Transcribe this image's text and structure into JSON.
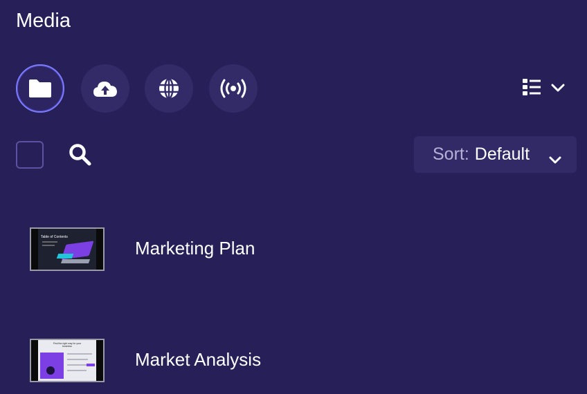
{
  "header": {
    "title": "Media"
  },
  "sources": [
    {
      "name": "folder-icon",
      "active": true
    },
    {
      "name": "cloud-upload-icon",
      "active": false
    },
    {
      "name": "globe-icon",
      "active": false
    },
    {
      "name": "broadcast-icon",
      "active": false
    }
  ],
  "toolbar": {
    "view_icon": "list-view-icon",
    "sort_label": "Sort:",
    "sort_value": "Default"
  },
  "items": [
    {
      "label": "Marketing Plan",
      "thumb_caption": "Table of Contents"
    },
    {
      "label": "Market Analysis",
      "thumb_caption": "Find the right way for your business"
    }
  ],
  "colors": {
    "background": "#271f57",
    "button": "#332b68",
    "accent": "#7c7cff",
    "thumb_purple": "#7b3fe4"
  }
}
